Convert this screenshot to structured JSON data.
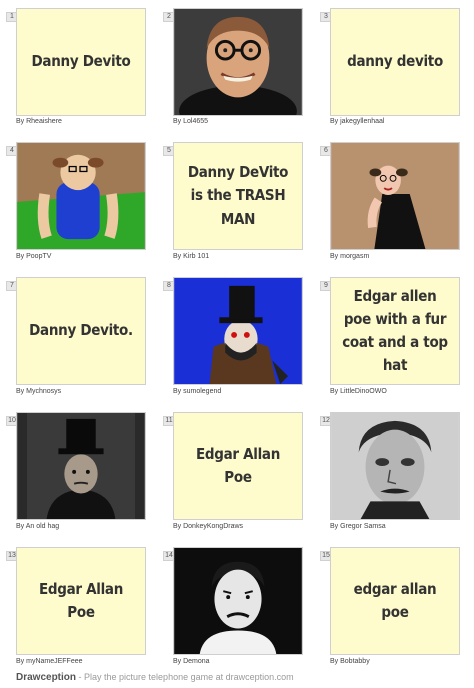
{
  "panels": [
    {
      "number": "1",
      "kind": "text",
      "caption": "Danny Devito",
      "author": "By Rheaishere"
    },
    {
      "number": "2",
      "kind": "image",
      "image": "danny-devito-portrait",
      "author": "By Lol4655"
    },
    {
      "number": "3",
      "kind": "text",
      "caption": "danny devito",
      "author": "By jakegyllenhaal"
    },
    {
      "number": "4",
      "kind": "image",
      "image": "devito-blue-tank-top-drawing",
      "author": "By PoopTV"
    },
    {
      "number": "5",
      "kind": "text",
      "caption": "Danny DeVito is the TRASH MAN",
      "author": "By Kirb 101"
    },
    {
      "number": "6",
      "kind": "image",
      "image": "devito-black-dress-drawing",
      "author": "By morgasm"
    },
    {
      "number": "7",
      "kind": "text",
      "caption": "Danny Devito.",
      "author": "By Mychnosys"
    },
    {
      "number": "8",
      "kind": "image",
      "image": "top-hat-fur-coat-drawing",
      "author": "By sumolegend"
    },
    {
      "number": "9",
      "kind": "text",
      "caption": "Edgar allen poe with a fur coat and a top hat",
      "author": "By LittleDinoOWO"
    },
    {
      "number": "10",
      "kind": "image",
      "image": "poe-top-hat-dark-drawing",
      "author": "By An old hag"
    },
    {
      "number": "11",
      "kind": "text",
      "caption": "Edgar Allan Poe",
      "author": "By DonkeyKongDraws"
    },
    {
      "number": "12",
      "kind": "image",
      "image": "poe-sketch-portrait",
      "author": "By Gregor Samsa"
    },
    {
      "number": "13",
      "kind": "text",
      "caption": "Edgar Allan Poe",
      "author": "By myNameJEFFeee"
    },
    {
      "number": "14",
      "kind": "image",
      "image": "poe-cartoon-drawing",
      "author": "By Demona"
    },
    {
      "number": "15",
      "kind": "text",
      "caption": "edgar allan poe",
      "author": "By Bobtabby"
    }
  ],
  "footer": {
    "brand": "Drawception",
    "tagline": " - Play the picture telephone game at drawception.com"
  },
  "colors": {
    "caption_background": "#fefccc",
    "caption_text": "#333333",
    "tagline": "#9a9a9a"
  }
}
